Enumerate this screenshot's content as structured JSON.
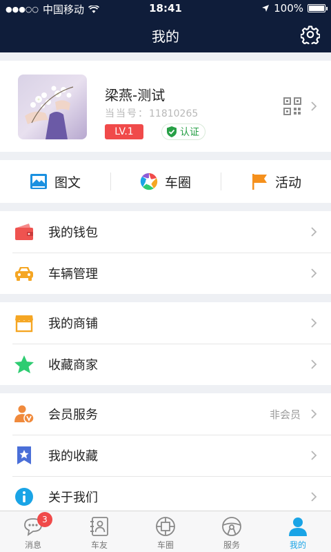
{
  "status_bar": {
    "signal": "●●●○○",
    "carrier": "中国移动",
    "time": "18:41",
    "battery": "100%"
  },
  "nav": {
    "title": "我的"
  },
  "profile": {
    "name": "梁燕-测试",
    "id_label": "当当号：",
    "id_value": "11810265",
    "level": "LV.1",
    "verified": "认证"
  },
  "quick_actions": [
    {
      "label": "图文",
      "icon": "image-icon"
    },
    {
      "label": "车圈",
      "icon": "color-wheel-icon"
    },
    {
      "label": "活动",
      "icon": "flag-icon"
    }
  ],
  "group1": [
    {
      "label": "我的钱包",
      "icon": "wallet-icon"
    },
    {
      "label": "车辆管理",
      "icon": "car-icon"
    }
  ],
  "group2": [
    {
      "label": "我的商铺",
      "icon": "shop-icon"
    },
    {
      "label": "收藏商家",
      "icon": "star-icon"
    }
  ],
  "group3": [
    {
      "label": "会员服务",
      "icon": "member-icon",
      "value": "非会员"
    },
    {
      "label": "我的收藏",
      "icon": "bookmark-icon"
    },
    {
      "label": "关于我们",
      "icon": "info-icon"
    }
  ],
  "tabs": [
    {
      "label": "消息",
      "icon": "message-icon",
      "badge": "3"
    },
    {
      "label": "车友",
      "icon": "contacts-icon"
    },
    {
      "label": "车圈",
      "icon": "circle-icon"
    },
    {
      "label": "服务",
      "icon": "steering-wheel-icon"
    },
    {
      "label": "我的",
      "icon": "person-icon",
      "active": true
    }
  ],
  "colors": {
    "nav_bg": "#0f1d3a",
    "accent": "#1aa4e6",
    "level_badge": "#f04a4a",
    "verify_green": "#27a046",
    "wallet_red": "#ef5350",
    "car_orange": "#f5a623",
    "shop_orange": "#f5a623",
    "star_green": "#2ecc71",
    "member_orange": "#f08a3c",
    "bookmark_blue": "#4a6fd8",
    "info_blue": "#1aa4e6"
  }
}
